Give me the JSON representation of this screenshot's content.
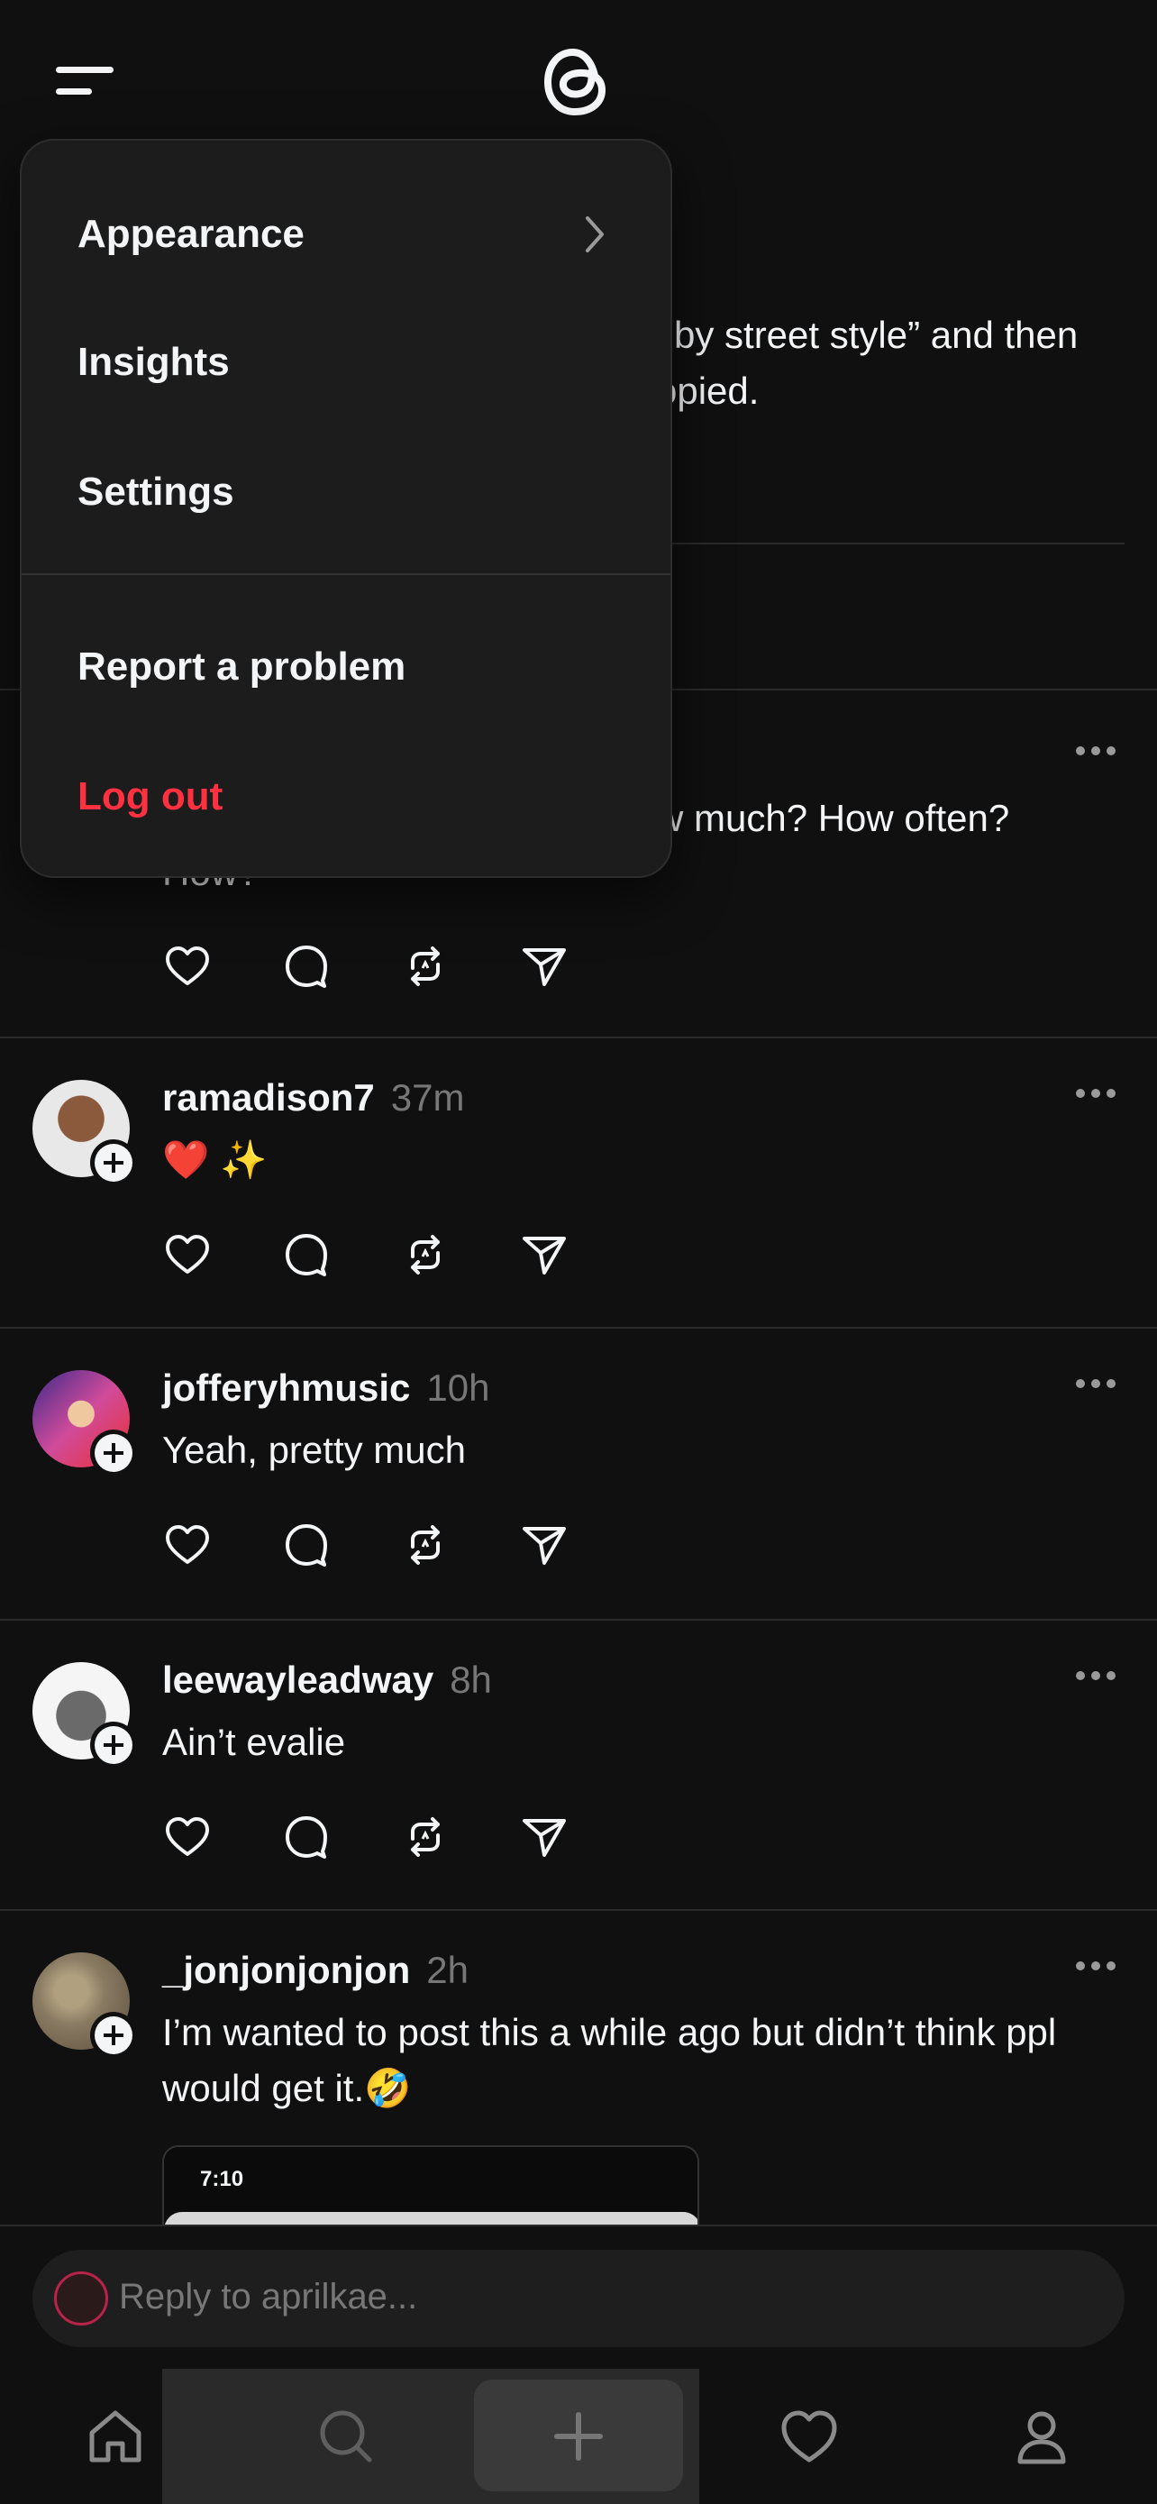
{
  "top": {
    "menu_icon": "hamburger-icon",
    "logo": "threads-logo"
  },
  "background_thread": {
    "line1": "by street style” and then",
    "line2": "opied.",
    "post_line1": "w much? How often?",
    "post_line2": "How?"
  },
  "menu": {
    "items": [
      {
        "label": "Appearance",
        "has_chevron": true
      },
      {
        "label": "Insights"
      },
      {
        "label": "Settings"
      },
      {
        "label": "Report a problem"
      },
      {
        "label": "Log out",
        "danger": true
      }
    ]
  },
  "posts": [
    {
      "username": "ramadison7",
      "time": "37m",
      "text": "❤️ ✨",
      "avatar_color": "#c9a27a"
    },
    {
      "username": "jofferyhmusic",
      "time": "10h",
      "text": "Yeah, pretty much",
      "avatar_color": "#d14b9b"
    },
    {
      "username": "leewayleadway",
      "time": "8h",
      "text": "Ain’t evalie",
      "avatar_color": "#9e9e9e"
    },
    {
      "username": "_jonjonjonjon",
      "time": "2h",
      "text": "I’m wanted to post this a while ago but didn’t think ppl would get it.🤣",
      "avatar_color": "#8a7b63"
    }
  ],
  "embedded_screenshot": {
    "time": "7:10"
  },
  "reply": {
    "placeholder": "Reply to aprilkae..."
  },
  "nav": {
    "items": [
      "home-icon",
      "search-icon",
      "create-icon",
      "heart-icon",
      "profile-icon"
    ]
  },
  "colors": {
    "background": "#101010",
    "danger": "#ff3040",
    "menu_bg": "#1c1c1c"
  }
}
